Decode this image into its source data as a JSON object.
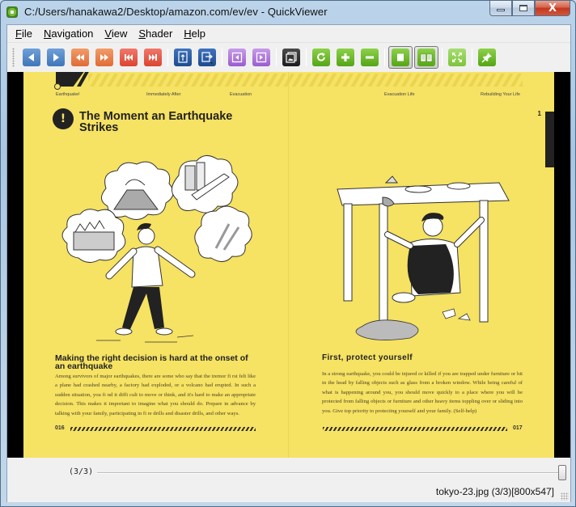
{
  "window": {
    "title": "C:/Users/hanakawa2/Desktop/amazon.com/ev/ev - QuickViewer",
    "app_icon": "quickviewer-app-icon",
    "controls": {
      "minimize": "minimize-icon",
      "maximize": "maximize-icon",
      "close": "close-icon",
      "close_glyph": "X"
    }
  },
  "menu": [
    {
      "label": "File",
      "mnemonic": "F",
      "rest": "ile"
    },
    {
      "label": "Navigation",
      "mnemonic": "N",
      "rest": "avigation"
    },
    {
      "label": "View",
      "mnemonic": "V",
      "rest": "iew"
    },
    {
      "label": "Shader",
      "mnemonic": "S",
      "rest": "hader"
    },
    {
      "label": "Help",
      "mnemonic": "H",
      "rest": "elp"
    }
  ],
  "toolbar": {
    "buttons": [
      {
        "name": "prev-page",
        "icon": "triangle-left-icon",
        "color": "#4f86c6"
      },
      {
        "name": "next-page",
        "icon": "triangle-right-icon",
        "color": "#4f86c6"
      },
      {
        "name": "fast-backward",
        "icon": "double-chevron-left-icon",
        "color": "#e87a45"
      },
      {
        "name": "fast-forward",
        "icon": "double-chevron-right-icon",
        "color": "#e87a45"
      },
      {
        "name": "first-page",
        "icon": "skip-to-start-icon",
        "color": "#e3533f"
      },
      {
        "name": "last-page",
        "icon": "skip-to-end-icon",
        "color": "#e3533f"
      },
      {
        "name": "open-folder",
        "icon": "folder-upload-icon",
        "color": "#2a5ea6"
      },
      {
        "name": "export",
        "icon": "export-file-icon",
        "color": "#2a5ea6"
      },
      {
        "name": "prev-volume",
        "icon": "volume-prev-icon",
        "color": "#ad78dc"
      },
      {
        "name": "next-volume",
        "icon": "volume-next-icon",
        "color": "#ad78dc"
      },
      {
        "name": "show-catalog",
        "icon": "image-gallery-icon",
        "color": "#2e2e2e"
      },
      {
        "name": "rotate",
        "icon": "rotate-icon",
        "color": "#6cbf2a"
      },
      {
        "name": "zoom-in",
        "icon": "plus-icon",
        "color": "#6cbf2a"
      },
      {
        "name": "zoom-out",
        "icon": "minus-icon",
        "color": "#6cbf2a"
      },
      {
        "name": "single-page-view",
        "icon": "single-page-icon",
        "color": "#6cbf2a",
        "toggled": true
      },
      {
        "name": "spread-view",
        "icon": "open-book-icon",
        "color": "#6cbf2a",
        "toggled": true
      },
      {
        "name": "fullscreen",
        "icon": "fullscreen-icon",
        "color": "#6cbf2a"
      },
      {
        "name": "stay-on-top",
        "icon": "pin-icon",
        "color": "#6cbf2a"
      }
    ]
  },
  "document": {
    "nav_labels": [
      "Earthquake!",
      "Immediately After",
      "Evacuation",
      "Evacuation Life",
      "Rebuilding Your Life"
    ],
    "chapter_number": "1",
    "title_icon": "!",
    "title": "The Moment an Earthquake Strikes",
    "left": {
      "section_title": "Making the right decision is hard at the onset of an earthquake",
      "body": "Among survivors of major earthquakes, there are some who say that the tremor fi rst felt like a plane had crashed nearby, a factory had exploded, or a volcano had erupted. In such a sudden situation, you fi nd it diffi cult to move or think, and it's hard to make an appropriate decision. This makes it important to imagine what you should do. Prepare in advance by talking with your family, participating in fi re drills and disaster drills, and other ways.",
      "page_number": "016",
      "illustration": "panicked-man-with-thought-bubbles"
    },
    "right": {
      "section_title": "First, protect yourself",
      "body": "In a strong earthquake, you could be injured or killed if you are trapped under furniture or hit in the head by falling objects such as glass from a broken window. While being careful of what is happening around you, you should move quickly to a place where you will be protected from falling objects or furniture and other heavy items toppling over or sliding into you. Give top priority to protecting yourself and your family. (Self-help)",
      "page_number": "017",
      "illustration": "man-sheltering-under-table"
    },
    "page_bg": "#f6e263"
  },
  "slider": {
    "label": "(3/3)",
    "position": "3/3",
    "fraction": 1.0
  },
  "status": {
    "text": "tokyo-23.jpg (3/3)[800x547]"
  }
}
